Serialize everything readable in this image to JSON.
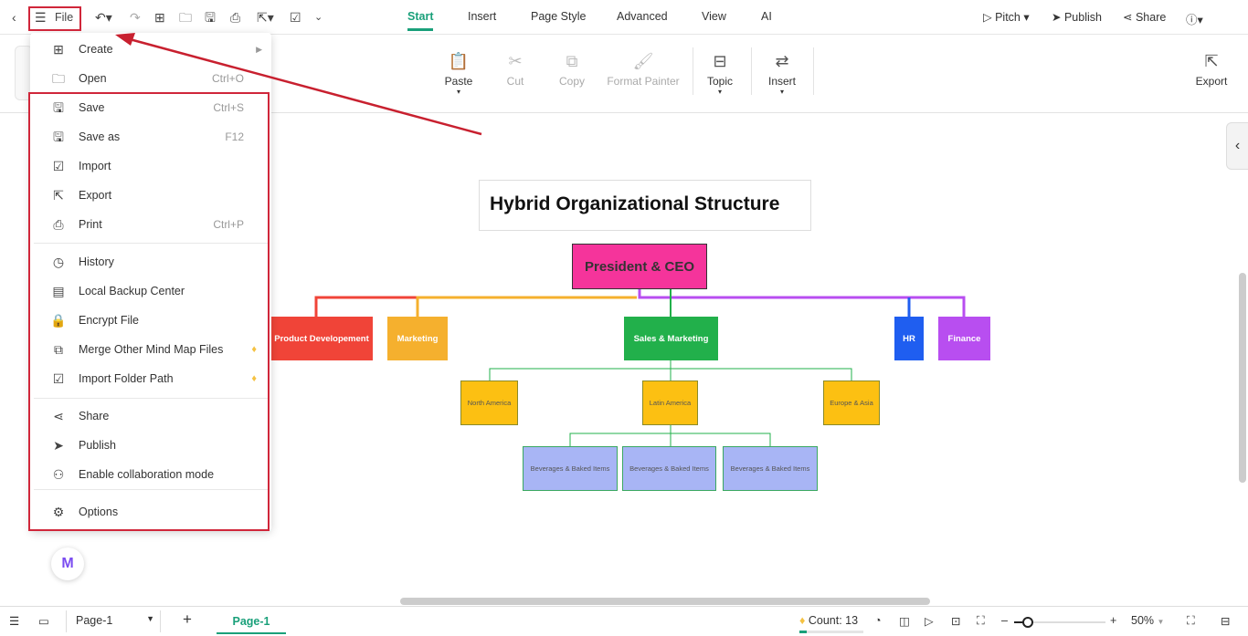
{
  "topbar": {
    "file_label": "File",
    "tabs": [
      "Start",
      "Insert",
      "Page Style",
      "Advanced",
      "View",
      "AI"
    ],
    "pitch": "Pitch",
    "publish": "Publish",
    "share": "Share"
  },
  "ribbon": {
    "paste": "Paste",
    "cut": "Cut",
    "copy": "Copy",
    "format_painter": "Format Painter",
    "topic": "Topic",
    "insert": "Insert",
    "export": "Export"
  },
  "file_menu": [
    {
      "label": "Create",
      "icon": "plus-box-icon",
      "submenu": true
    },
    {
      "label": "Open",
      "icon": "folder-icon",
      "shortcut": "Ctrl+O"
    },
    {
      "label": "Save",
      "icon": "save-icon",
      "shortcut": "Ctrl+S"
    },
    {
      "label": "Save as",
      "icon": "save-as-icon",
      "shortcut": "F12"
    },
    {
      "label": "Import",
      "icon": "import-icon"
    },
    {
      "label": "Export",
      "icon": "export-icon"
    },
    {
      "label": "Print",
      "icon": "print-icon",
      "shortcut": "Ctrl+P"
    },
    {
      "label": "History",
      "icon": "history-icon"
    },
    {
      "label": "Local Backup Center",
      "icon": "backup-icon"
    },
    {
      "label": "Encrypt File",
      "icon": "lock-file-icon"
    },
    {
      "label": "Merge Other Mind Map Files",
      "icon": "merge-icon",
      "premium": true
    },
    {
      "label": "Import Folder Path",
      "icon": "folder-import-icon",
      "premium": true
    },
    {
      "label": "Share",
      "icon": "share-icon"
    },
    {
      "label": "Publish",
      "icon": "publish-icon"
    },
    {
      "label": "Enable collaboration mode",
      "icon": "collaboration-icon"
    },
    {
      "label": "Options",
      "icon": "gear-icon"
    }
  ],
  "diagram": {
    "title": "Hybrid Organizational Structure",
    "root": "President & CEO",
    "departments": [
      {
        "label": "Product Developement",
        "color": "#f04438"
      },
      {
        "label": "Marketing",
        "color": "#f5b02e"
      },
      {
        "label": "Sales & Marketing",
        "color": "#22b04b"
      },
      {
        "label": "HR",
        "color": "#1f5ef0"
      },
      {
        "label": "Finance",
        "color": "#b84ef0"
      }
    ],
    "regions": [
      "North America",
      "Latin America",
      "Europe & Asia"
    ],
    "items": [
      "Beverages & Baked Items",
      "Beverages & Baked Items",
      "Beverages & Baked Items"
    ]
  },
  "status": {
    "page_select": "Page-1",
    "page_tab": "Page-1",
    "count": "Count: 13",
    "zoom": "50%",
    "zoom_percent": 50
  }
}
